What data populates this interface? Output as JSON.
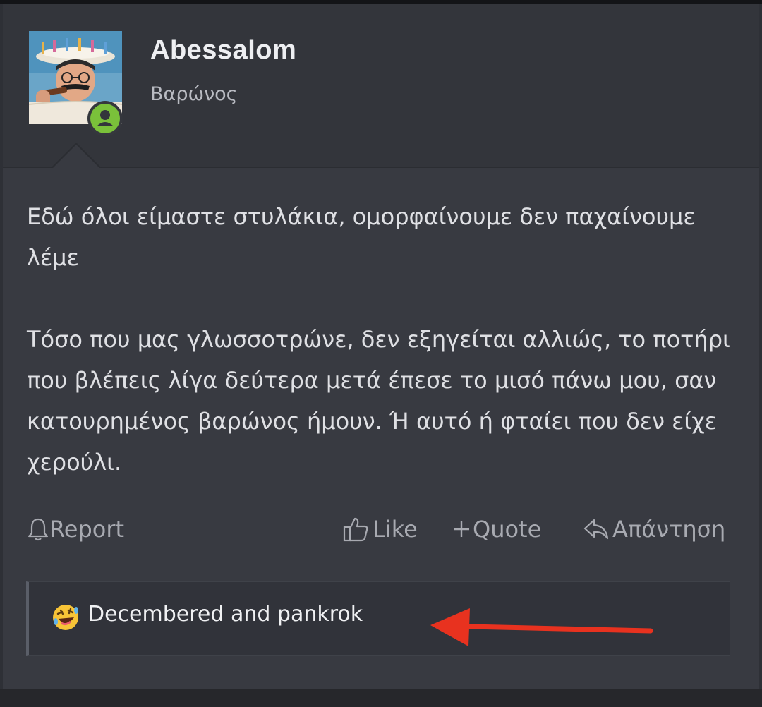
{
  "post": {
    "author": {
      "name": "Abessalom",
      "title": "Βαρώνος",
      "avatar_icon": "user-avatar-photo",
      "online_icon": "online-user-icon",
      "online_color": "#7ac13a"
    },
    "body": {
      "paragraph_1": "Εδώ όλοι είμαστε στυλάκια, ομορφαίνουμε δεν παχαίνουμε λέμε",
      "paragraph_2": "Τόσο που μας γλωσσοτρώνε, δεν εξηγείται αλλιώς, το ποτήρι που βλέπεις λίγα δεύτερα μετά έπεσε το μισό πάνω μου, σαν κατουρημένος βαρώνος ήμουν. Ή αυτό ή φταίει που δεν είχε χερούλι."
    },
    "actions": {
      "report_label": "Report",
      "report_icon": "bell-icon",
      "like_label": "Like",
      "like_icon": "thumbs-up-icon",
      "quote_label": "Quote",
      "quote_icon": "plus-icon",
      "reply_label": "Απάντηση",
      "reply_icon": "reply-icon"
    },
    "reactions": {
      "icon": "rolling-laughing-emoji",
      "text": "Decembered and pankrok"
    }
  },
  "annotation": {
    "arrow_color": "#e8321f"
  }
}
